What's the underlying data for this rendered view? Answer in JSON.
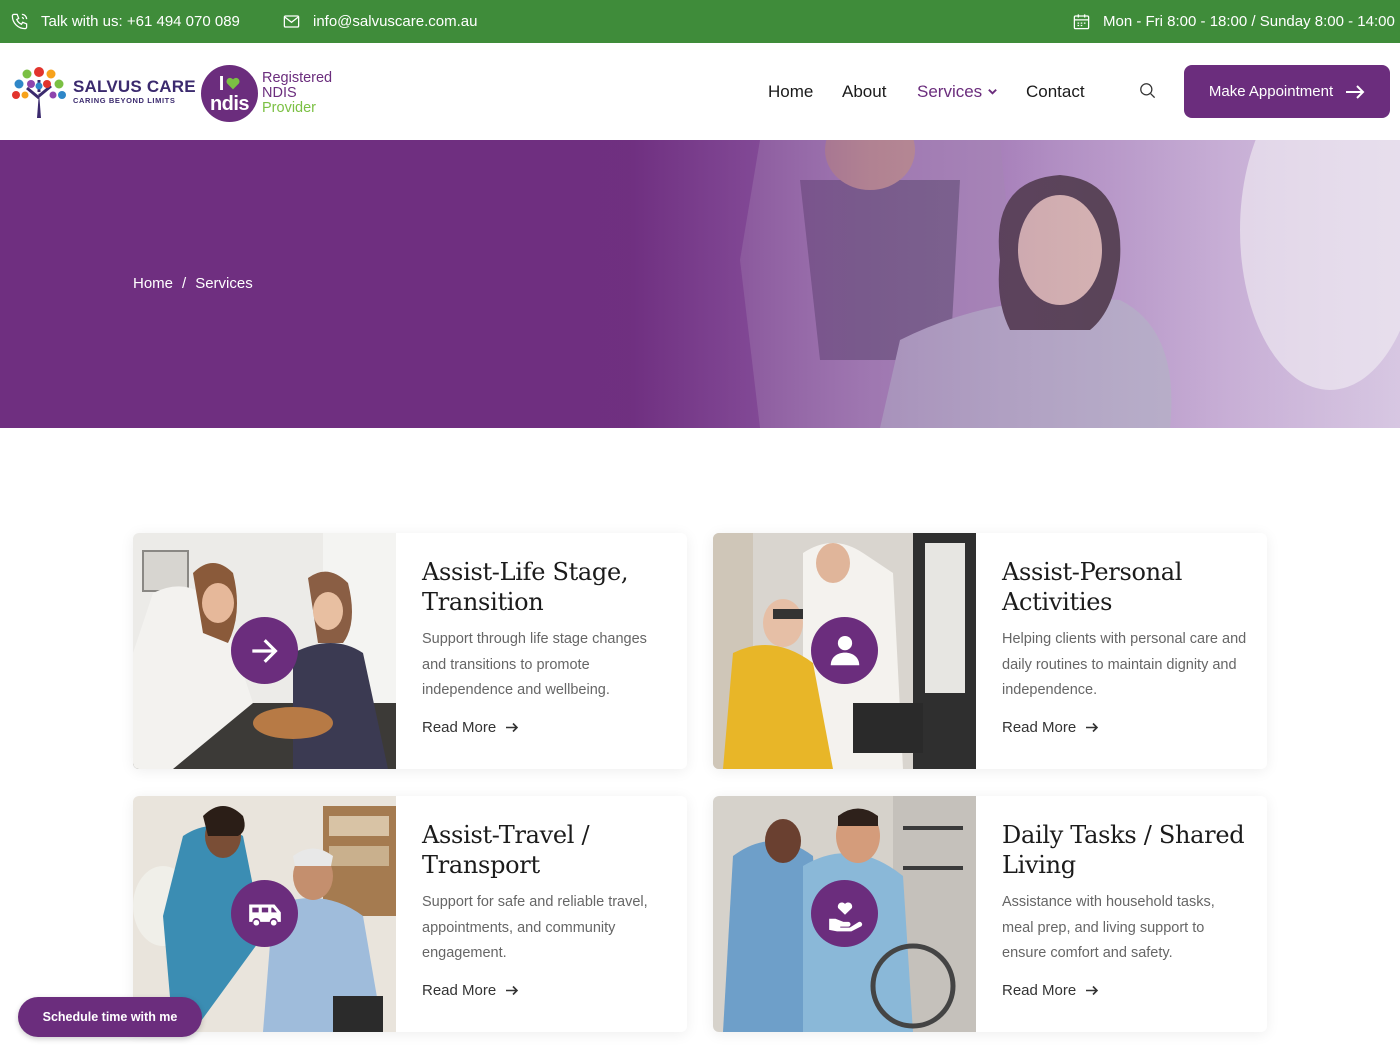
{
  "topbar": {
    "phone_text": "Talk with us: +61 494 070 089",
    "email_text": "info@salvuscare.com.au",
    "hours_text": "Mon - Fri 8:00 - 18:00 / Sunday 8:00 - 14:00"
  },
  "brand": {
    "name": "SALVUS CARE",
    "tagline": "CARING BEYOND LIMITS",
    "ndis_i": "I",
    "ndis_word": "ndis",
    "ndis_line1": "Registered",
    "ndis_line2": "NDIS",
    "ndis_line3": "Provider"
  },
  "nav": {
    "home": "Home",
    "about": "About",
    "services": "Services",
    "contact": "Contact",
    "cta": "Make Appointment"
  },
  "breadcrumb": {
    "home": "Home",
    "separator": "/",
    "current": "Services"
  },
  "cards": [
    {
      "title": "Assist-Life Stage, Transition",
      "text": "Support through life stage changes and transitions to promote independence and wellbeing.",
      "link": "Read More",
      "icon": "arrow-right-icon"
    },
    {
      "title": "Assist-Personal Activities",
      "text": "Helping clients with personal care and daily routines to maintain dignity and independence.",
      "link": "Read More",
      "icon": "person-icon"
    },
    {
      "title": "Assist-Travel / Transport",
      "text": "Support for safe and reliable travel, appointments, and community engagement.",
      "link": "Read More",
      "icon": "van-icon"
    },
    {
      "title": "Daily Tasks / Shared Living",
      "text": "Assistance with household tasks, meal prep, and living support to ensure comfort and safety.",
      "link": "Read More",
      "icon": "heart-hand-icon"
    }
  ],
  "schedule_button": "Schedule time with me",
  "colors": {
    "topbar": "#3f8c3a",
    "brand_purple": "#6b2d7d",
    "ndis_green": "#7bc043"
  }
}
